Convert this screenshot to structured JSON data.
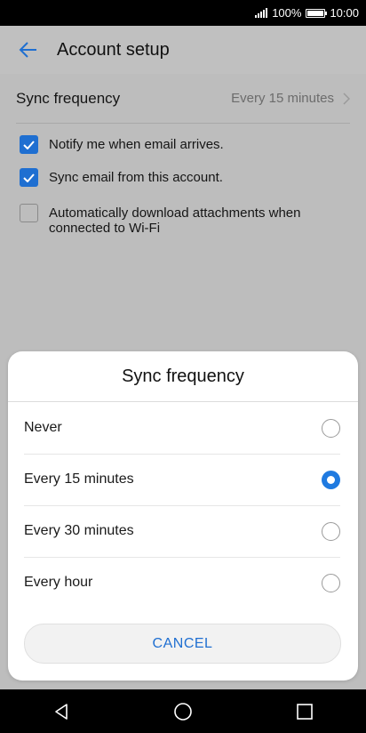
{
  "status_bar": {
    "battery": "100%",
    "time": "10:00"
  },
  "app_bar": {
    "title": "Account setup"
  },
  "settings": {
    "sync_frequency": {
      "label": "Sync frequency",
      "value": "Every 15 minutes"
    },
    "checkboxes": [
      {
        "label": "Notify me when email arrives.",
        "checked": true
      },
      {
        "label": "Sync email from this account.",
        "checked": true
      },
      {
        "label": "Automatically download attachments when connected to Wi-Fi",
        "checked": false
      }
    ]
  },
  "dialog": {
    "title": "Sync frequency",
    "options": [
      {
        "label": "Never",
        "selected": false
      },
      {
        "label": "Every 15 minutes",
        "selected": true
      },
      {
        "label": "Every 30 minutes",
        "selected": false
      },
      {
        "label": "Every hour",
        "selected": false
      }
    ],
    "cancel_label": "CANCEL"
  },
  "colors": {
    "accent": "#1f6fd1",
    "scrim": "#bdbdbd"
  }
}
